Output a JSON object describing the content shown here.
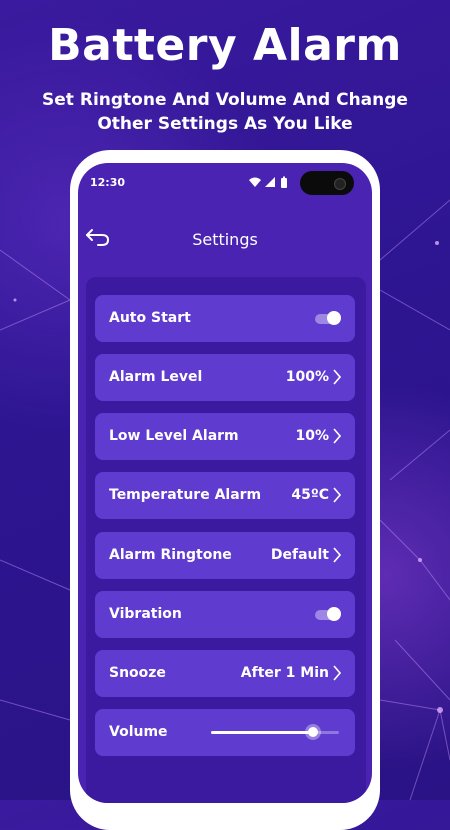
{
  "hero": {
    "title": "Battery Alarm",
    "subtitle_line1": "Set Ringtone And Volume And Change",
    "subtitle_line2": "Other Settings As You Like"
  },
  "statusbar": {
    "time": "12:30",
    "icons": [
      "wifi-icon",
      "signal-icon",
      "battery-icon"
    ]
  },
  "header": {
    "back_icon": "back-arrow-icon",
    "title": "Settings"
  },
  "settings": {
    "auto_start": {
      "label": "Auto Start",
      "enabled": true
    },
    "alarm_level": {
      "label": "Alarm Level",
      "value": "100%"
    },
    "low_level_alarm": {
      "label": "Low Level Alarm",
      "value": "10%"
    },
    "temperature_alarm": {
      "label": "Temperature Alarm",
      "value": "45ºC"
    },
    "alarm_ringtone": {
      "label": "Alarm Ringtone",
      "value": "Default"
    },
    "vibration": {
      "label": "Vibration",
      "enabled": true
    },
    "snooze": {
      "label": "Snooze",
      "value": "After 1 Min"
    },
    "volume": {
      "label": "Volume",
      "level": 0.8
    }
  },
  "colors": {
    "accent": "#5f3bd0",
    "panel": "#3b1a9f",
    "screen": "#4a23b2"
  }
}
